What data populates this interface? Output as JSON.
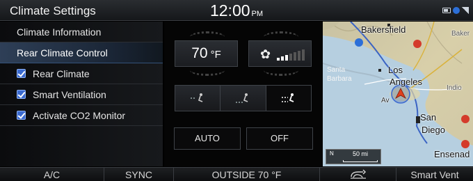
{
  "status": {
    "title": "Climate Settings",
    "time": "12:00",
    "ampm": "PM",
    "icons": [
      "battery-icon",
      "bluetooth-icon",
      "signal-icon"
    ]
  },
  "menu": {
    "items": [
      {
        "label": "Climate Information",
        "selected": false,
        "checkbox": false
      },
      {
        "label": "Rear Climate Control",
        "selected": true,
        "checkbox": false
      },
      {
        "label": "Rear Climate",
        "selected": false,
        "checkbox": true,
        "checked": true
      },
      {
        "label": "Smart Ventilation",
        "selected": false,
        "checkbox": true,
        "checked": true
      },
      {
        "label": "Activate CO2 Monitor",
        "selected": false,
        "checkbox": true,
        "checked": true
      }
    ]
  },
  "controls": {
    "temperature": "70",
    "temperature_unit": "°F",
    "fan_icon": "fan-icon",
    "fan_level": 3,
    "fan_level_max": 7,
    "modes": [
      "vent-face-icon",
      "vent-feet-icon",
      "vent-face-feet-icon"
    ],
    "active_mode": 2,
    "auto_label": "AUTO",
    "off_label": "OFF"
  },
  "map": {
    "labels": {
      "bakersfield": "Bakersfield",
      "baker": "Baker",
      "los_angeles_1": "Los",
      "los_angeles_2": "Angeles",
      "santa_barbara_1": "Santa",
      "santa_barbara_2": "Barbara",
      "indio": "Indio",
      "san_diego_1": "San",
      "san_diego_2": "Diego",
      "ensenada": "Ensenad",
      "avalon": "Av"
    },
    "scale_direction": "N",
    "scale": "50 mi"
  },
  "bottom": {
    "ac": "A/C",
    "sync": "SYNC",
    "outside": "OUTSIDE  70 °F",
    "recirc_icon": "recirculation-icon",
    "smart_vent": "Smart Vent"
  },
  "colors": {
    "accent": "#3a6ad0",
    "selected_row": "#2e3f57",
    "fan_level_on": "#ffffff",
    "fan_level_off": "#555555"
  }
}
